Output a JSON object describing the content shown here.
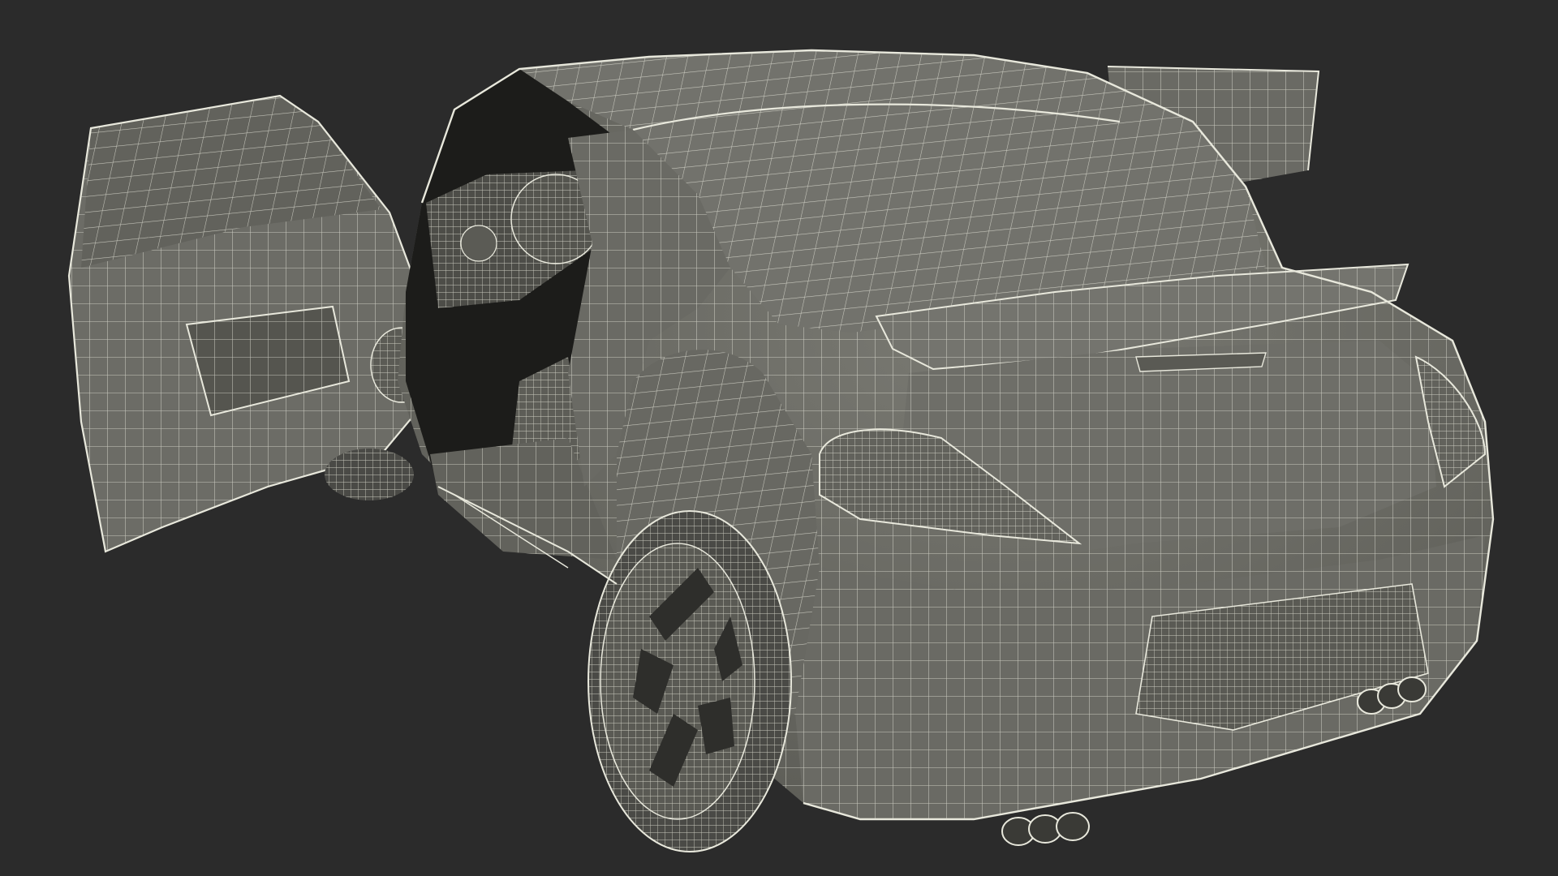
{
  "scene": {
    "subject": "wireframe-car-model",
    "background_color": "#2b2b2b",
    "body_color": "#6e6e68",
    "body_shadow_color": "#55554f",
    "wire_color": "#e8e8dc",
    "interior_color": "#1c1c1a",
    "tire_color": "#4a4a46"
  }
}
